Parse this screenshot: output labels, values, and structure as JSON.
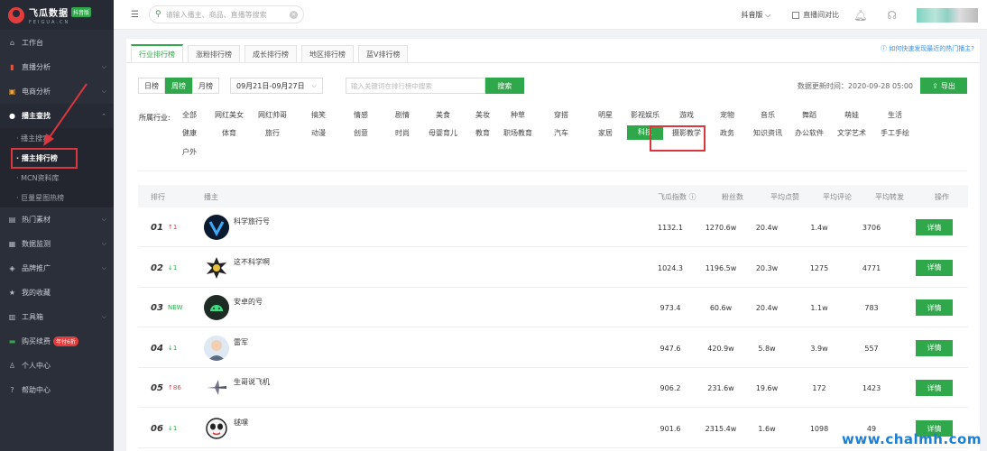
{
  "brand": {
    "title": "飞瓜数据",
    "badge": "抖音版",
    "sub": "FEIGUA.CN"
  },
  "sidebar": {
    "items": [
      {
        "label": "工作台",
        "icon": "home-icon"
      },
      {
        "label": "直播分析",
        "icon": "bar-chart-icon"
      },
      {
        "label": "电商分析",
        "icon": "shop-icon"
      },
      {
        "label": "播主查找",
        "icon": "user-search-icon"
      }
    ],
    "sub_items": [
      {
        "label": "· 播主搜索"
      },
      {
        "label": "· 播主排行榜"
      },
      {
        "label": "· MCN资料库"
      },
      {
        "label": "· 巨量星图热榜"
      }
    ],
    "items2": [
      {
        "label": "热门素材",
        "icon": "film-icon"
      },
      {
        "label": "数据监测",
        "icon": "monitor-icon"
      },
      {
        "label": "品牌推广",
        "icon": "tag-icon"
      },
      {
        "label": "我的收藏",
        "icon": "star-icon"
      },
      {
        "label": "工具箱",
        "icon": "toolbox-icon"
      },
      {
        "label": "购买续费",
        "icon": "cart-icon",
        "promo": "年付6折"
      },
      {
        "label": "个人中心",
        "icon": "person-icon"
      },
      {
        "label": "帮助中心",
        "icon": "help-icon"
      }
    ]
  },
  "topbar": {
    "search_placeholder": "请输入播主、商品、直播等搜索",
    "platform": "抖音版 ⌵",
    "compare": "直播间对比"
  },
  "tabs": [
    "行业排行榜",
    "涨粉排行榜",
    "成长排行榜",
    "地区排行榜",
    "蓝V排行榜"
  ],
  "help_link": "ⓘ 如何快速发现最近的热门播主?",
  "period": [
    "日榜",
    "周榜",
    "月榜"
  ],
  "date_range": "09月21日-09月27日",
  "keyword_placeholder": "输入关键词在排行榜中搜索",
  "search_button": "搜索",
  "update_time": "数据更新时间：2020-09-28 05:00",
  "export_button": "导出",
  "industry_label": "所属行业:",
  "industries": [
    [
      "全部",
      "网红美女",
      "网红帅哥",
      "搞笑",
      "情感",
      "剧情",
      "美食",
      "美妆",
      "种草",
      "穿搭",
      "明星",
      "影视娱乐",
      "游戏",
      "宠物",
      "音乐",
      "舞蹈",
      "萌娃",
      "生活"
    ],
    [
      "健康",
      "体育",
      "旅行",
      "动漫",
      "创意",
      "时尚",
      "母婴育儿",
      "教育",
      "职场教育",
      "汽车",
      "家居",
      "科技",
      "摄影教学",
      "政务",
      "知识资讯",
      "办公软件",
      "文学艺术",
      "手工手绘"
    ],
    [
      "户外"
    ]
  ],
  "selected_industry": "科技",
  "table": {
    "headers": [
      "排行",
      "播主",
      "飞瓜指数 ⓘ",
      "粉丝数",
      "平均点赞",
      "平均评论",
      "平均转发",
      "操作"
    ],
    "rows": [
      {
        "rank": "01",
        "change": "↑1",
        "dir": "up",
        "name": "科学旅行号",
        "index": "1132.1",
        "fans": "1270.6w",
        "likes": "20.4w",
        "comments": "1.4w",
        "shares": "3706"
      },
      {
        "rank": "02",
        "change": "↓1",
        "dir": "down",
        "name": "这不科学啊",
        "index": "1024.3",
        "fans": "1196.5w",
        "likes": "20.3w",
        "comments": "1275",
        "shares": "4771"
      },
      {
        "rank": "03",
        "change": "NEW",
        "dir": "new",
        "name": "安卓的号",
        "index": "973.4",
        "fans": "60.6w",
        "likes": "20.4w",
        "comments": "1.1w",
        "shares": "783"
      },
      {
        "rank": "04",
        "change": "↓1",
        "dir": "down",
        "name": "雷军",
        "index": "947.6",
        "fans": "420.9w",
        "likes": "5.8w",
        "comments": "3.9w",
        "shares": "557"
      },
      {
        "rank": "05",
        "change": "↑86",
        "dir": "up",
        "name": "生哥说飞机",
        "index": "906.2",
        "fans": "231.6w",
        "likes": "19.6w",
        "comments": "172",
        "shares": "1423"
      },
      {
        "rank": "06",
        "change": "↓1",
        "dir": "down",
        "name": "毬嘿",
        "index": "901.6",
        "fans": "2315.4w",
        "likes": "1.6w",
        "comments": "1098",
        "shares": "49"
      }
    ],
    "detail_label": "详情"
  },
  "watermark": "www.chalmh.com",
  "colors": {
    "accent": "#2ea84a",
    "sidebar": "#2b2f3a",
    "highlight": "#d9363e"
  }
}
